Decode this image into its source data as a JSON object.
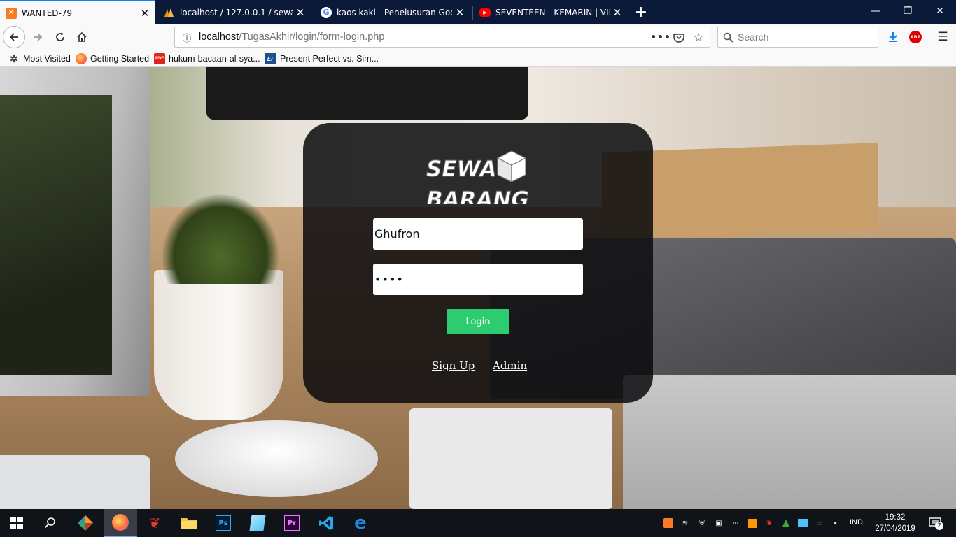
{
  "browser": {
    "tabs": [
      {
        "title": "WANTED-79",
        "active": true,
        "favicon": "xampp-icon"
      },
      {
        "title": "localhost / 127.0.0.1 / sewa_bar",
        "active": false,
        "favicon": "phpmyadmin-icon"
      },
      {
        "title": "kaos kaki - Penelusuran Google",
        "active": false,
        "favicon": "google-icon"
      },
      {
        "title": "SEVENTEEN - KEMARIN | VIDEO",
        "active": false,
        "favicon": "youtube-icon"
      }
    ],
    "url_host": "localhost",
    "url_path": "/TugasAkhir/login/form-login.php",
    "search_placeholder": "Search",
    "bookmarks": [
      {
        "label": "Most Visited",
        "icon": "gear-icon"
      },
      {
        "label": "Getting Started",
        "icon": "firefox-icon"
      },
      {
        "label": "hukum-bacaan-al-sya...",
        "icon": "pdf-icon"
      },
      {
        "label": "Present Perfect vs. Sim...",
        "icon": "ef-icon"
      }
    ],
    "abp_label": "ABP"
  },
  "login": {
    "logo_line1": "SEWA",
    "logo_line2": "BARANG",
    "username_value": "Ghufron",
    "password_value": "••••",
    "login_label": "Login",
    "signup_label": "Sign Up",
    "admin_label": "Admin",
    "accent_color": "#2ecc71"
  },
  "taskbar": {
    "language": "IND",
    "time": "19:32",
    "date": "27/04/2019",
    "notification_count": "2"
  }
}
